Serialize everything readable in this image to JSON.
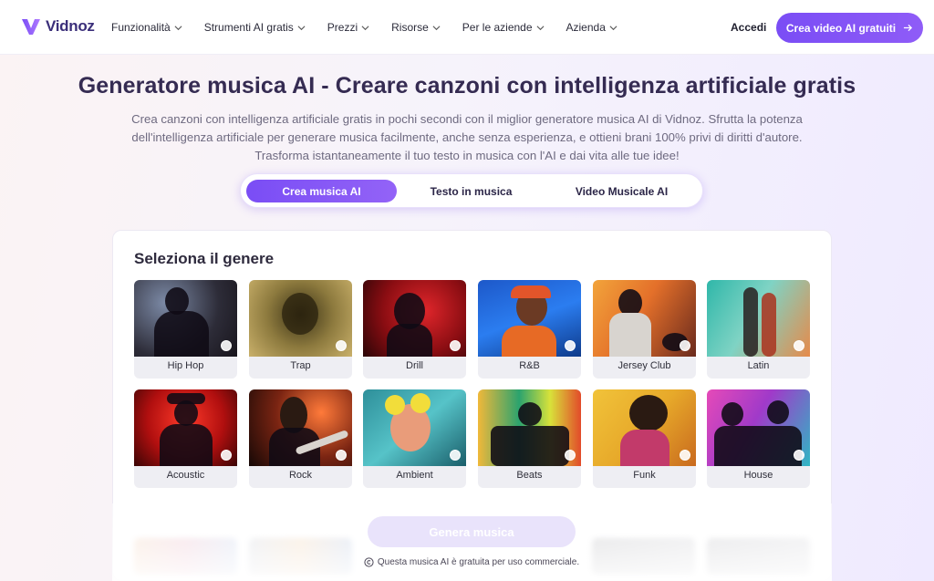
{
  "nav": {
    "brand": "Vidnoz",
    "items": [
      {
        "label": "Funzionalità"
      },
      {
        "label": "Strumenti AI gratis"
      },
      {
        "label": "Prezzi"
      },
      {
        "label": "Risorse"
      },
      {
        "label": "Per le aziende"
      },
      {
        "label": "Azienda"
      }
    ],
    "login": "Accedi",
    "cta": "Crea video AI gratuiti"
  },
  "hero": {
    "title": "Generatore musica AI - Creare canzoni con intelligenza artificiale gratis",
    "subtitle": "Crea canzoni con intelligenza artificiale gratis in pochi secondi con il miglior generatore musica AI di Vidnoz. Sfrutta la potenza dell'intelligenza artificiale per generare musica facilmente, anche senza esperienza, e ottieni brani 100% privi di diritti d'autore. Trasforma istantaneamente il tuo testo in musica con l'AI e dai vita alle tue idee!"
  },
  "tabs": [
    {
      "label": "Crea musica AI",
      "active": true
    },
    {
      "label": "Testo in musica",
      "active": false
    },
    {
      "label": "Video Musicale AI",
      "active": false
    }
  ],
  "genre_section": {
    "title": "Seleziona il genere",
    "genres": [
      {
        "label": "Hip Hop"
      },
      {
        "label": "Trap"
      },
      {
        "label": "Drill"
      },
      {
        "label": "R&B"
      },
      {
        "label": "Jersey Club"
      },
      {
        "label": "Latin"
      },
      {
        "label": "Acoustic"
      },
      {
        "label": "Rock"
      },
      {
        "label": "Ambient"
      },
      {
        "label": "Beats"
      },
      {
        "label": "Funk"
      },
      {
        "label": "House"
      }
    ]
  },
  "generate_button": "Genera musica",
  "notice": "Questa musica AI è gratuita per uso commerciale.",
  "colors": {
    "accent": "#7a4df5",
    "title": "#352b52",
    "muted": "#6e6a80"
  }
}
